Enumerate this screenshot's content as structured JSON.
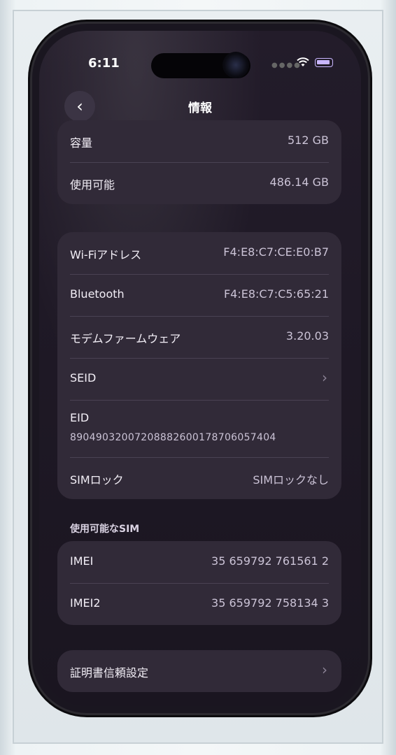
{
  "status_bar": {
    "time": "6:11",
    "icons": [
      "wifi-icon",
      "battery-icon"
    ]
  },
  "nav": {
    "title": "情報",
    "back_icon": "chevron-left-icon"
  },
  "storage": [
    {
      "label": "容量",
      "value": "512 GB"
    },
    {
      "label": "使用可能",
      "value": "486.14 GB"
    }
  ],
  "network": {
    "wifi": {
      "label": "Wi-Fiアドレス",
      "value": "F4:E8:C7:CE:E0:B7"
    },
    "bluetooth": {
      "label": "Bluetooth",
      "value": "F4:E8:C7:C5:65:21"
    },
    "modem": {
      "label": "モデムファームウェア",
      "value": "3.20.03"
    },
    "seid": {
      "label": "SEID"
    },
    "eid": {
      "label": "EID",
      "value": "89049032007208882600178706057404"
    },
    "simlock": {
      "label": "SIMロック",
      "value": "SIMロックなし"
    }
  },
  "sim_section": {
    "header": "使用可能なSIM",
    "rows": [
      {
        "label": "IMEI",
        "value": "35 659792 761561 2"
      },
      {
        "label": "IMEI2",
        "value": "35 659792 758134 3"
      }
    ]
  },
  "cert": {
    "label": "証明書信頼設定"
  },
  "colors": {
    "screen_bg": "#1f1926",
    "group_bg": "#312a38",
    "accent": "#c9b6ff"
  }
}
